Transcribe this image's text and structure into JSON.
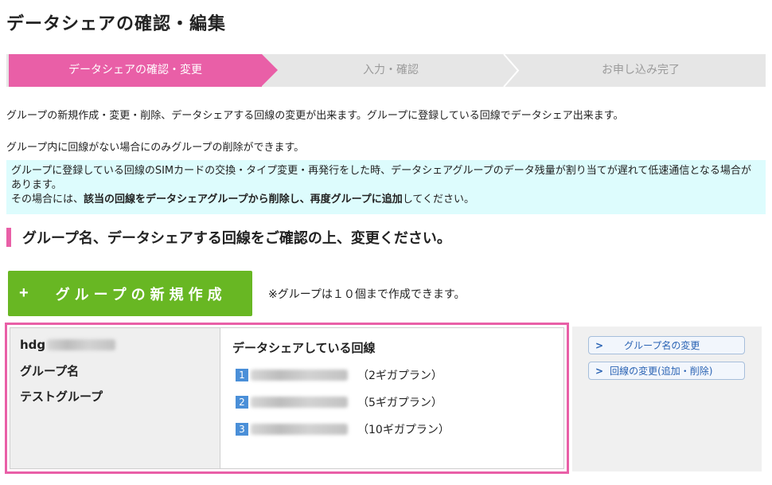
{
  "page": {
    "title": "データシェアの確認・編集"
  },
  "steps": [
    {
      "label": "データシェアの確認・変更",
      "active": true
    },
    {
      "label": "入力・確認",
      "active": false
    },
    {
      "label": "お申し込み完了",
      "active": false
    }
  ],
  "descriptions": {
    "line1": "グループの新規作成・変更・削除、データシェアする回線の変更が出来ます。グループに登録している回線でデータシェア出来ます。",
    "line2": "グループ内に回線がない場合にのみグループの削除ができます。"
  },
  "notice": {
    "text1": "グループに登録している回線のSIMカードの交換・タイプ変更・再発行をした時、データシェアグループのデータ残量が割り当てが遅れて低速通信となる場合があります。",
    "text2_prefix": "その場合には、",
    "text2_bold": "該当の回線をデータシェアグループから削除し、再度グループに追加",
    "text2_suffix": "してください。"
  },
  "section": {
    "heading": "グループ名、データシェアする回線をご確認の上、変更ください。"
  },
  "new_group": {
    "plus": "+",
    "label": "グループの新規作成",
    "note": "※グループは１０個まで作成できます。"
  },
  "group": {
    "id_prefix": "hdg",
    "name_label": "グループ名",
    "name": "テストグループ",
    "lines_title": "データシェアしている回線",
    "lines": [
      {
        "num": "1",
        "plan": "（2ギガプラン）"
      },
      {
        "num": "2",
        "plan": "（5ギガプラン）"
      },
      {
        "num": "3",
        "plan": "（10ギガプラン）"
      }
    ]
  },
  "actions": {
    "rename": "グループ名の変更",
    "change_lines": "回線の変更(追加・削除)"
  },
  "colors": {
    "accent_pink": "#e95fa7",
    "button_green": "#68b723",
    "notice_bg": "#ddfcfd",
    "line_badge_blue": "#4a8fd8",
    "link_blue": "#2a63b4"
  }
}
